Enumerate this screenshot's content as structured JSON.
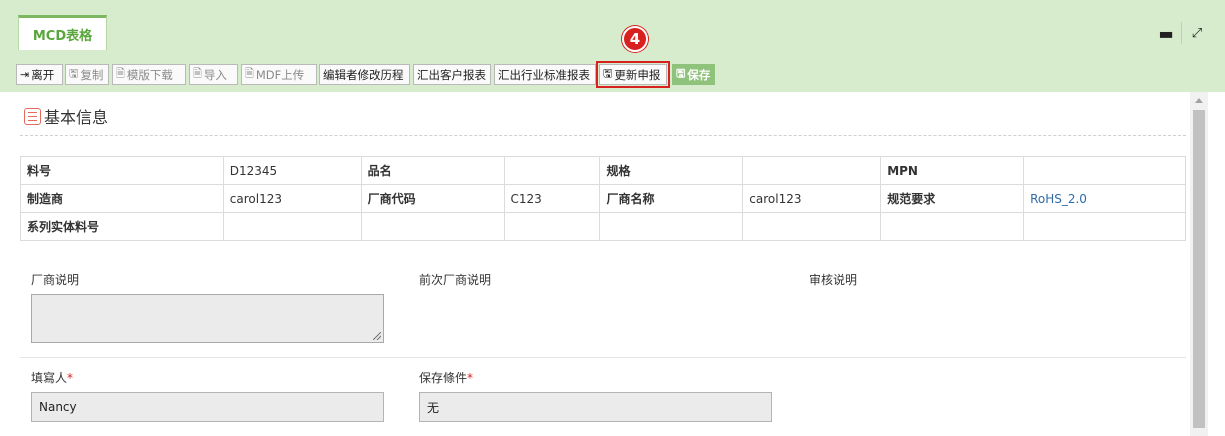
{
  "tab": {
    "title": "MCD表格"
  },
  "window": {
    "minimize_icon": "minus-icon",
    "maximize_icon": "expand-icon"
  },
  "toolbar": {
    "leave": "离开",
    "copy": "复制",
    "template_download": "模版下载",
    "import": "导入",
    "mdf_upload": "MDF上传",
    "editor_history": "编辑者修改历程",
    "export_customer": "汇出客户报表",
    "export_industry": "汇出行业标准报表",
    "update_declaration": "更新申报",
    "save": "保存"
  },
  "step_badge": "4",
  "section": {
    "title": "基本信息"
  },
  "info_table": {
    "row1": {
      "l1": "料号",
      "v1": "D12345",
      "l2": "品名",
      "v2": "",
      "l3": "规格",
      "v3": "",
      "l4": "MPN",
      "v4": ""
    },
    "row2": {
      "l1": "制造商",
      "v1": "carol123",
      "l2": "厂商代码",
      "v2": "C123",
      "l3": "厂商名称",
      "v3": "carol123",
      "l4": "规范要求",
      "v4": "RoHS_2.0"
    },
    "row3": {
      "l1": "系列实体料号",
      "v1": "",
      "l2": "",
      "v2": "",
      "l3": "",
      "v3": "",
      "l4": "",
      "v4": ""
    }
  },
  "fields": {
    "vendor_note_label": "厂商说明",
    "prev_vendor_note_label": "前次厂商说明",
    "audit_note_label": "审核说明",
    "filler_label": "填寫人",
    "filler_value": "Nancy",
    "storage_label": "保存條件",
    "storage_value": "无",
    "required_mark": "*"
  }
}
